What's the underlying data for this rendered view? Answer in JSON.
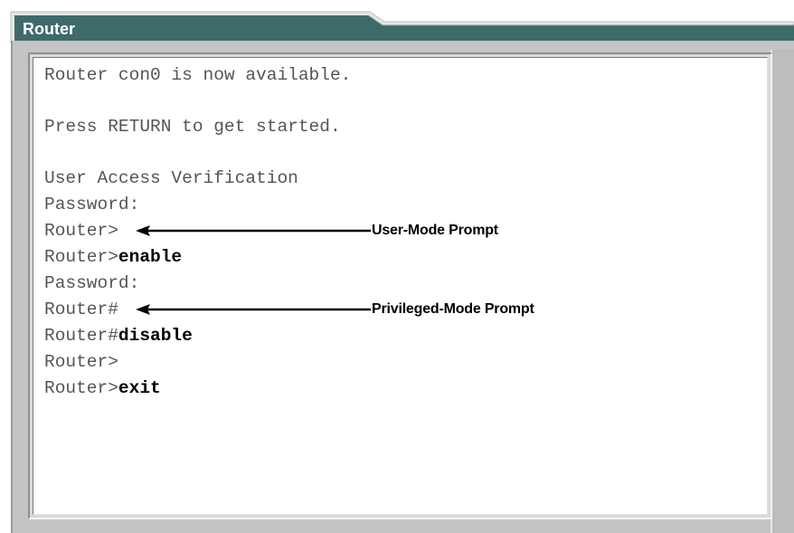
{
  "window": {
    "title": "Router"
  },
  "colors": {
    "title_bar": "#3f6a6a",
    "frame": "#c4c4c4",
    "terminal_bg": "#ffffff"
  },
  "terminal": {
    "lines": [
      {
        "prefix": "Router con0 is now available.",
        "command": ""
      },
      {
        "prefix": "",
        "command": ""
      },
      {
        "prefix": "Press RETURN to get started.",
        "command": ""
      },
      {
        "prefix": "",
        "command": ""
      },
      {
        "prefix": "User Access Verification",
        "command": ""
      },
      {
        "prefix": "Password:",
        "command": ""
      },
      {
        "prefix": "Router>",
        "command": ""
      },
      {
        "prefix": "Router>",
        "command": "enable"
      },
      {
        "prefix": "Password:",
        "command": ""
      },
      {
        "prefix": "Router#",
        "command": ""
      },
      {
        "prefix": "Router#",
        "command": "disable"
      },
      {
        "prefix": "Router>",
        "command": ""
      },
      {
        "prefix": "Router>",
        "command": "exit"
      }
    ]
  },
  "annotations": {
    "user_mode": "User-Mode Prompt",
    "privileged_mode": "Privileged-Mode Prompt"
  }
}
